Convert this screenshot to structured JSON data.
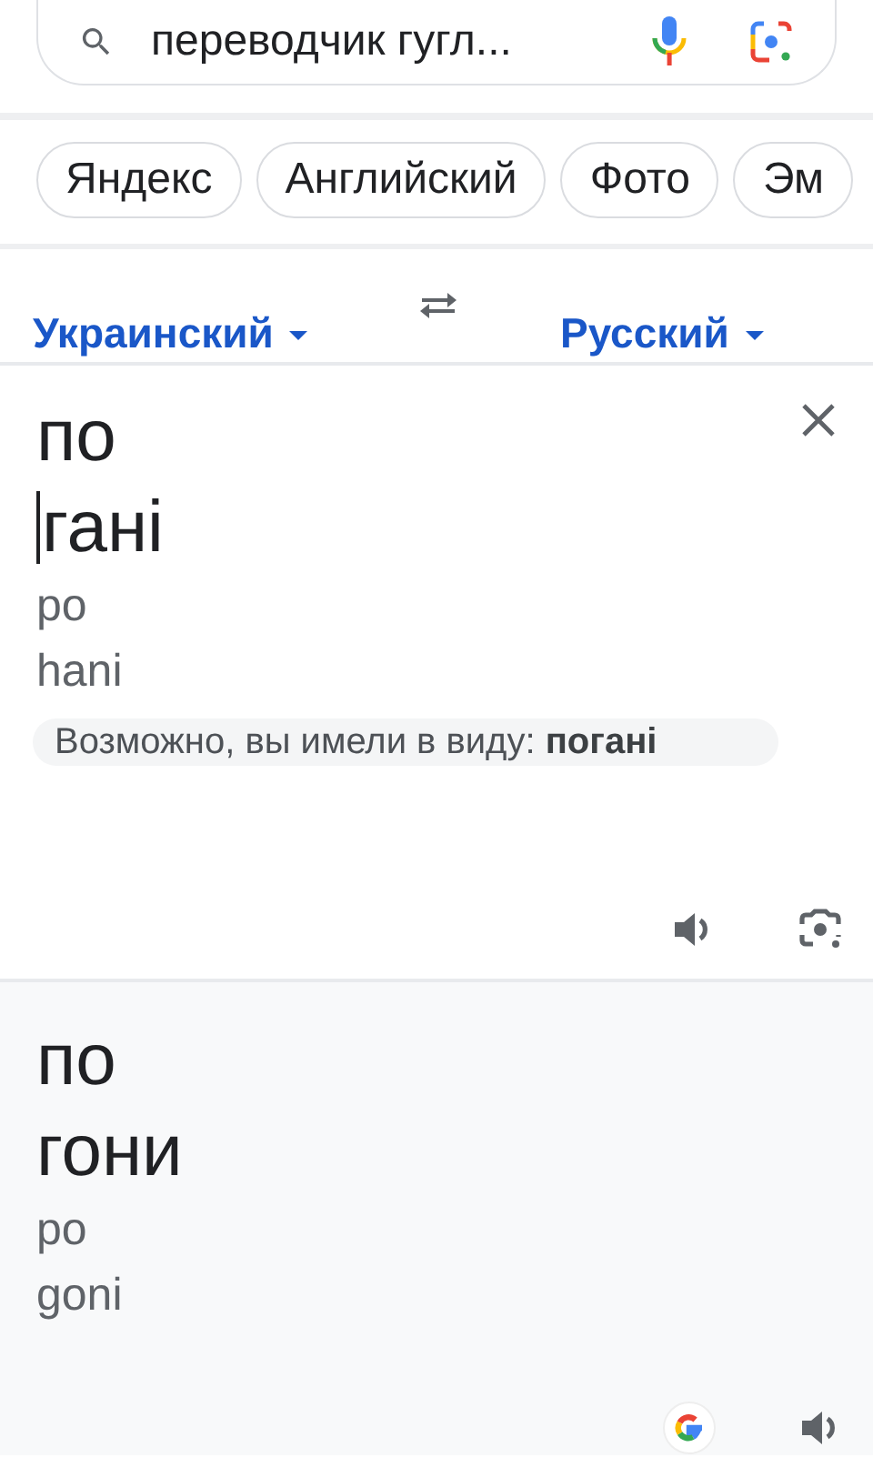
{
  "search": {
    "value": "переводчик гугл..."
  },
  "chips": [
    {
      "label": "Яндекс"
    },
    {
      "label": "Английский"
    },
    {
      "label": "Фото"
    },
    {
      "label": "Эм"
    }
  ],
  "languages": {
    "source": "Украинский",
    "target": "Русский"
  },
  "source": {
    "lines": [
      {
        "text": "по",
        "cursor": false
      },
      {
        "text": "гані",
        "cursor": true
      }
    ],
    "transliteration": [
      "po",
      "hani"
    ],
    "suggestion": "Возможно, вы имели в виду: **погані**"
  },
  "result": {
    "lines": [
      "по",
      "гони"
    ],
    "transliteration": [
      "po",
      "goni"
    ]
  }
}
